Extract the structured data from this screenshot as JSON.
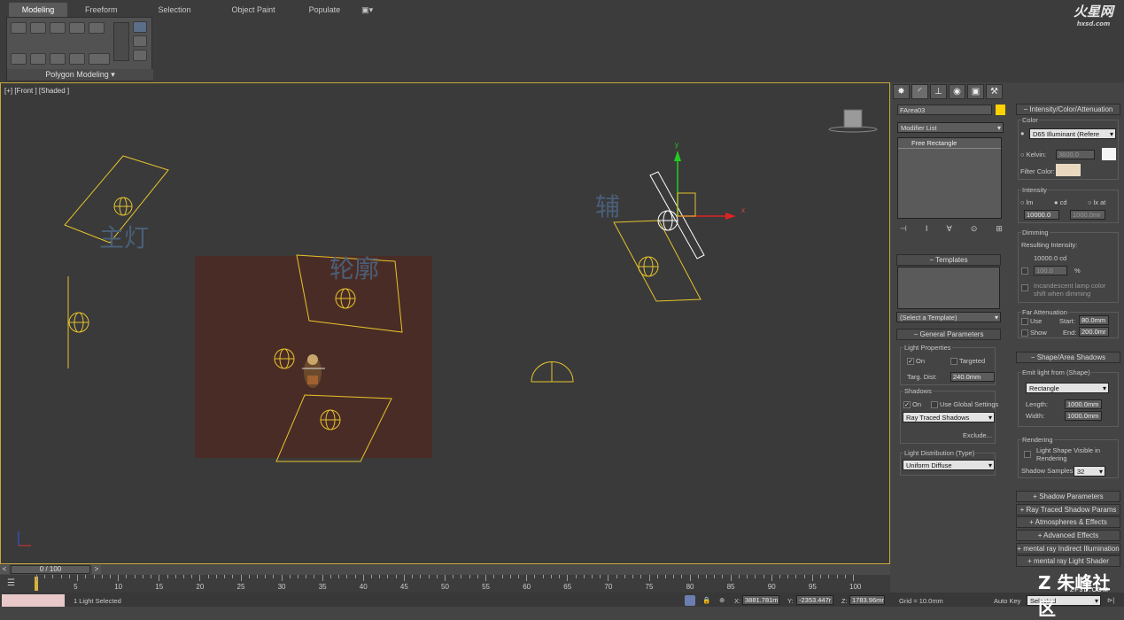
{
  "ribbon": {
    "tabs": [
      "Modeling",
      "Freeform",
      "Selection",
      "Object Paint",
      "Populate"
    ],
    "panel_label": "Polygon Modeling",
    "logo_main": "火星网",
    "logo_sub": "hxsd.com"
  },
  "viewport": {
    "label": "[+] [Front ] [Shaded ]",
    "annotations": [
      "主灯",
      "轮廓",
      "辅"
    ],
    "axis_x": "x",
    "axis_y": "y"
  },
  "command_panel": {
    "object_name": "FArea03",
    "object_color": "#ffd200",
    "modifier_list": "Modifier List",
    "stack_item": "Free Rectangle",
    "templates_header": "Templates",
    "template_select": "(Select a Template)",
    "general_header": "General Parameters",
    "light_properties": "Light Properties",
    "on_label": "On",
    "targeted_label": "Targeted",
    "targ_dist_label": "Targ. Dist:",
    "targ_dist_value": "240.0mm",
    "shadows_label": "Shadows",
    "shadows_on": "On",
    "use_global": "Use Global Settings",
    "shadow_type": "Ray Traced Shadows",
    "exclude_btn": "Exclude...",
    "distribution_label": "Light Distribution (Type)",
    "distribution_value": "Uniform Diffuse"
  },
  "right_panel": {
    "header": "Intensity/Color/Attenuation",
    "color_group": "Color",
    "illuminant": "D65 Illuminant (Refere",
    "kelvin_label": "Kelvin:",
    "kelvin_value": "3600.0",
    "filter_color_label": "Filter Color:",
    "intensity_group": "Intensity",
    "lm": "lm",
    "cd": "cd",
    "lx_at": "lx at",
    "intensity_value": "10000.0",
    "lx_value": "1000.0mr",
    "dimming_group": "Dimming",
    "resulting_label": "Resulting Intensity:",
    "resulting_value": "10000.0 cd",
    "dim_percent": "100.0",
    "percent_sign": "%",
    "incandescent": "Incandescent lamp color shift when dimming",
    "far_atten_group": "Far Attenuation",
    "use_label": "Use",
    "show_label": "Show",
    "start_label": "Start:",
    "start_value": "80.0mm",
    "end_label": "End:",
    "end_value": "200.0mr",
    "shape_header": "Shape/Area Shadows",
    "emit_group": "Emit light from (Shape)",
    "shape_value": "Rectangle",
    "length_label": "Length:",
    "length_value": "1000.0mm",
    "width_label": "Width:",
    "width_value": "1000.0mm",
    "rendering_group": "Rendering",
    "light_shape_visible": "Light Shape Visible in Rendering",
    "shadow_samples_label": "Shadow Samples:",
    "shadow_samples_value": "32",
    "rollouts": [
      "Shadow Parameters",
      "Ray Traced Shadow Params",
      "Atmospheres & Effects",
      "Advanced Effects",
      "mental ray Indirect Illumination",
      "mental ray Light Shader"
    ]
  },
  "timeline": {
    "frame": "0 / 100",
    "ticks": [
      "5",
      "10",
      "15",
      "20",
      "25",
      "30",
      "35",
      "40",
      "45",
      "50",
      "55",
      "60",
      "65",
      "70",
      "75",
      "80",
      "85",
      "90",
      "95",
      "100"
    ]
  },
  "status": {
    "selection": "1 Light Selected",
    "x_label": "X:",
    "x_value": "3881.781m",
    "y_label": "Y:",
    "y_value": "-2353.447r",
    "z_label": "Z:",
    "z_value": "1783.96mr",
    "grid": "Grid = 10.0mm",
    "auto_key": "Auto Key",
    "selected_dd": "Selected",
    "watermark": "朱峰社区",
    "watermark_sub": "ZF3D.COM"
  }
}
